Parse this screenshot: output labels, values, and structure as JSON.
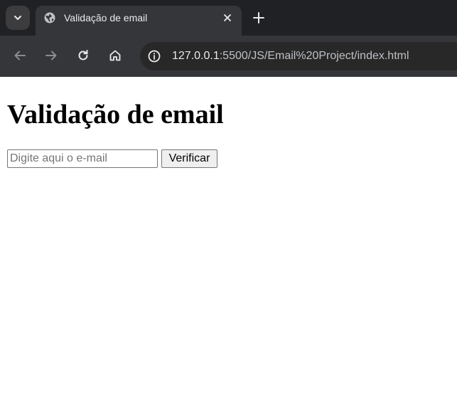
{
  "browser": {
    "tab": {
      "title": "Validação de email",
      "favicon": "globe-icon",
      "close_icon": "close-icon"
    },
    "tab_search_icon": "chevron-down-icon",
    "new_tab_icon": "plus-icon",
    "toolbar": {
      "back_icon": "arrow-left-icon",
      "forward_icon": "arrow-right-icon",
      "reload_icon": "reload-icon",
      "home_icon": "home-icon",
      "site_info_icon": "info-icon"
    },
    "url": {
      "host": "127.0.0.1",
      "rest": ":5500/JS/Email%20Project/index.html"
    }
  },
  "page": {
    "title": "Validação de email",
    "email_input": {
      "placeholder": "Digite aqui o e-mail",
      "value": ""
    },
    "verify_button_label": "Verificar"
  },
  "colors": {
    "tabstrip_bg": "#202124",
    "toolbar_bg": "#35363a",
    "omnibox_bg": "#282828",
    "page_bg": "#ffffff"
  }
}
